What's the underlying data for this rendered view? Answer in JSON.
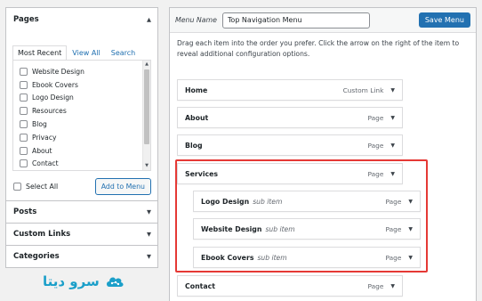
{
  "pages_panel": {
    "title": "Pages",
    "tabs": [
      "Most Recent",
      "View All",
      "Search"
    ],
    "items": [
      "Website Design",
      "Ebook Covers",
      "Logo Design",
      "Resources",
      "Blog",
      "Privacy",
      "About",
      "Contact"
    ],
    "select_all": "Select All",
    "add_button": "Add to Menu"
  },
  "accordions": [
    "Posts",
    "Custom Links",
    "Categories"
  ],
  "logo": {
    "text": "سرو دیتا",
    "color": "#1b9fc9"
  },
  "menu": {
    "name_label": "Menu Name",
    "name_value": "Top Navigation Menu",
    "save_label": "Save Menu",
    "instructions": "Drag each item into the order you prefer. Click the arrow on the right of the item to reveal additional configuration options.",
    "items": [
      {
        "title": "Home",
        "type": "Custom Link",
        "sub": ""
      },
      {
        "title": "About",
        "type": "Page",
        "sub": ""
      },
      {
        "title": "Blog",
        "type": "Page",
        "sub": ""
      },
      {
        "title": "Services",
        "type": "Page",
        "sub": ""
      },
      {
        "title": "Logo Design",
        "type": "Page",
        "sub": "sub item"
      },
      {
        "title": "Website Design",
        "type": "Page",
        "sub": "sub item"
      },
      {
        "title": "Ebook Covers",
        "type": "Page",
        "sub": "sub item"
      },
      {
        "title": "Contact",
        "type": "Page",
        "sub": ""
      }
    ]
  },
  "colors": {
    "accent": "#2271b1",
    "highlight": "#e53935"
  }
}
